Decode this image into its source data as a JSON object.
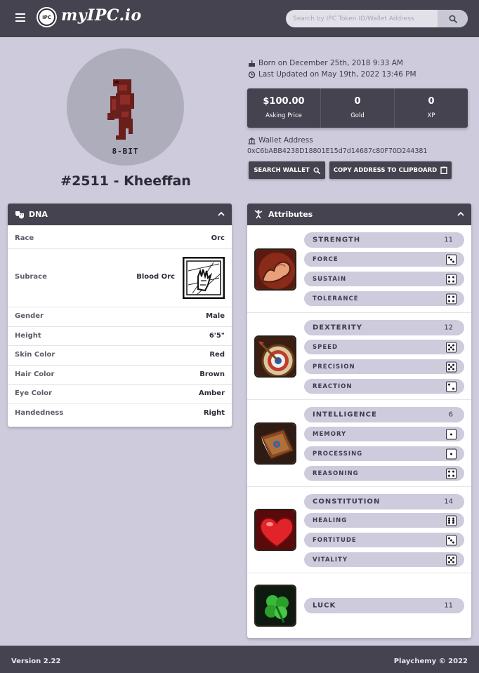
{
  "header": {
    "logo_badge": "IPC",
    "logo_text": "myIPC.io",
    "search_placeholder": "Search by IPC Token ID/Wallet Address"
  },
  "profile": {
    "tag": "8-BIT",
    "name": "#2511 - Kheeffan",
    "born": "Born on December 25th, 2018 9:33 AM",
    "updated": "Last Updated on May 19th, 2022 13:46 PM",
    "stats": [
      {
        "value": "$100.00",
        "label": "Asking Price"
      },
      {
        "value": "0",
        "label": "Gold"
      },
      {
        "value": "0",
        "label": "XP"
      }
    ],
    "wallet_label": "Wallet Address",
    "wallet_address": "0xC6bABB4238D18801E15d7d14687c80F70D244381",
    "search_wallet_label": "SEARCH WALLET",
    "copy_label": "COPY ADDRESS TO CLIPBOARD"
  },
  "dna": {
    "title": "DNA",
    "rows": [
      {
        "key": "Race",
        "value": "Orc"
      },
      {
        "key": "Subrace",
        "value": "Blood Orc"
      },
      {
        "key": "Gender",
        "value": "Male"
      },
      {
        "key": "Height",
        "value": "6'5\""
      },
      {
        "key": "Skin Color",
        "value": "Red"
      },
      {
        "key": "Hair Color",
        "value": "Brown"
      },
      {
        "key": "Eye Color",
        "value": "Amber"
      },
      {
        "key": "Handedness",
        "value": "Right"
      }
    ]
  },
  "attributes": {
    "title": "Attributes",
    "groups": [
      {
        "name": "STRENGTH",
        "value": "11",
        "icon": "flexed-arm-icon",
        "subs": [
          {
            "name": "FORCE",
            "die": 3
          },
          {
            "name": "SUSTAIN",
            "die": 4
          },
          {
            "name": "TOLERANCE",
            "die": 4
          }
        ]
      },
      {
        "name": "DEXTERITY",
        "value": "12",
        "icon": "archery-target-icon",
        "subs": [
          {
            "name": "SPEED",
            "die": 5
          },
          {
            "name": "PRECISION",
            "die": 5
          },
          {
            "name": "REACTION",
            "die": 2
          }
        ]
      },
      {
        "name": "INTELLIGENCE",
        "value": "6",
        "icon": "spell-book-icon",
        "subs": [
          {
            "name": "MEMORY",
            "die": 1
          },
          {
            "name": "PROCESSING",
            "die": 1
          },
          {
            "name": "REASONING",
            "die": 4
          }
        ]
      },
      {
        "name": "CONSTITUTION",
        "value": "14",
        "icon": "heart-icon",
        "subs": [
          {
            "name": "HEALING",
            "die": 6
          },
          {
            "name": "FORTITUDE",
            "die": 3
          },
          {
            "name": "VITALITY",
            "die": 5
          }
        ]
      }
    ],
    "luck": {
      "name": "LUCK",
      "value": "11",
      "icon": "four-leaf-clover-icon"
    }
  },
  "footer": {
    "version": "Version 2.22",
    "copyright": "Playchemy © 2022"
  },
  "colors": {
    "background": "#cdcbdc",
    "dark": "#45434f",
    "pill": "#cdcbdc"
  }
}
